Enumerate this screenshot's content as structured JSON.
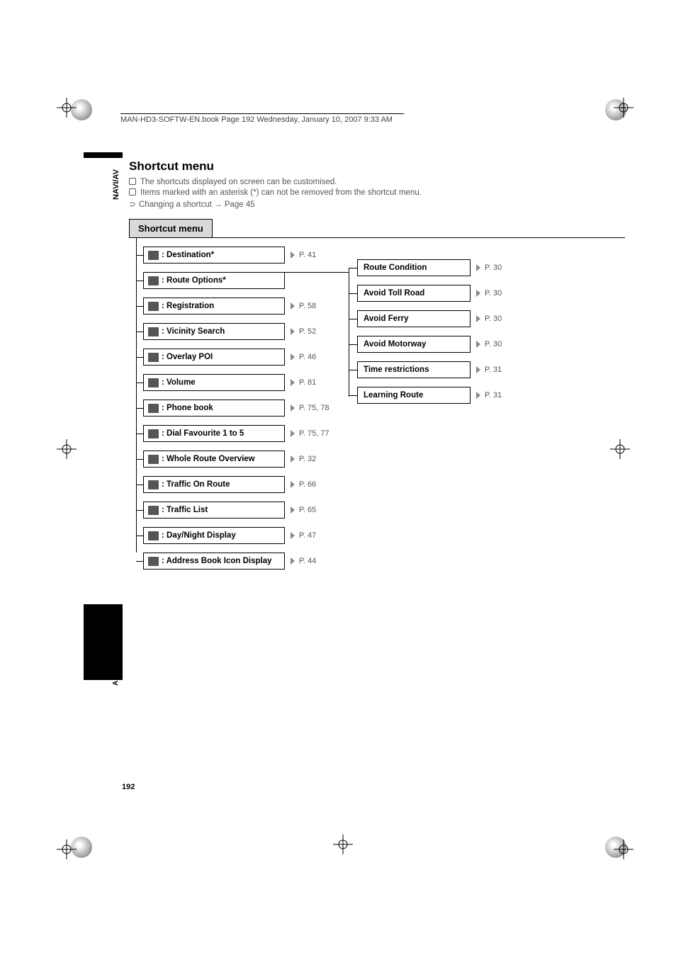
{
  "header": {
    "running_header": "MAN-HD3-SOFTW-EN.book  Page 192  Wednesday, January 10, 2007  9:33 AM"
  },
  "side_labels": {
    "top": "NAVI/AV",
    "bottom": "Appendix"
  },
  "page_number": "192",
  "title": "Shortcut menu",
  "notes": {
    "n1": "The shortcuts displayed on screen can be customised.",
    "n2": "Items marked with an asterisk (*) can not be removed from the shortcut menu.",
    "n3_prefix": "Changing a shortcut",
    "n3_arrow": "→",
    "n3_suffix": "Page 45"
  },
  "menu": {
    "header": "Shortcut menu",
    "items": [
      {
        "label": ": Destination*",
        "page": "P. 41",
        "icon": true
      },
      {
        "label": ": Route Options*",
        "page": "",
        "icon": true
      },
      {
        "label": ": Registration",
        "page": "P. 58",
        "icon": true
      },
      {
        "label": ": Vicinity Search",
        "page": "P. 52",
        "icon": true
      },
      {
        "label": ": Overlay POI",
        "page": "P. 46",
        "icon": true
      },
      {
        "label": ": Volume",
        "page": "P. 81",
        "icon": true
      },
      {
        "label": ": Phone book",
        "page": "P. 75, 78",
        "icon": true
      },
      {
        "label": ": Dial Favourite 1 to 5",
        "page": "P. 75, 77",
        "icon": true
      },
      {
        "label": ": Whole Route Overview",
        "page": "P. 32",
        "icon": true
      },
      {
        "label": ": Traffic On Route",
        "page": "P. 66",
        "icon": true
      },
      {
        "label": ": Traffic List",
        "page": "P. 65",
        "icon": true
      },
      {
        "label": ": Day/Night Display",
        "page": "P. 47",
        "icon": true
      },
      {
        "label": ": Address Book Icon Display",
        "page": "P. 44",
        "icon": true
      }
    ],
    "sub_items": [
      {
        "label": "Route Condition",
        "page": "P. 30"
      },
      {
        "label": "Avoid Toll Road",
        "page": "P. 30"
      },
      {
        "label": "Avoid Ferry",
        "page": "P. 30"
      },
      {
        "label": "Avoid Motorway",
        "page": "P. 30"
      },
      {
        "label": "Time restrictions",
        "page": "P. 31"
      },
      {
        "label": "Learning Route",
        "page": "P. 31"
      }
    ]
  }
}
